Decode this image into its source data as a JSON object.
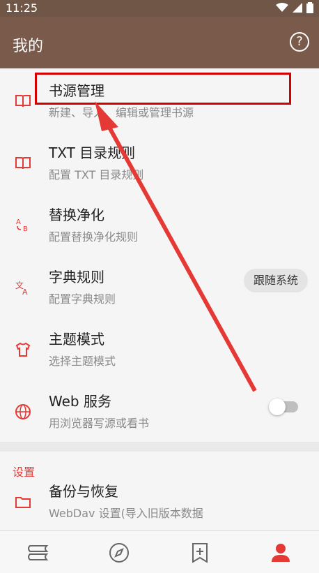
{
  "status": {
    "time": "11:25"
  },
  "appbar": {
    "title": "我的",
    "help_label": "?"
  },
  "items": [
    {
      "title": "书源管理",
      "subtitle": "新建、导入、编辑或管理书源",
      "icon": "book-icon"
    },
    {
      "title": "TXT 目录规则",
      "subtitle": "配置 TXT 目录规则",
      "icon": "book-icon"
    },
    {
      "title": "替换净化",
      "subtitle": "配置替换净化规则",
      "icon": "replace-ab-icon"
    },
    {
      "title": "字典规则",
      "subtitle": "配置字典规则",
      "icon": "translate-icon"
    },
    {
      "title": "主题模式",
      "subtitle": "选择主题模式",
      "icon": "shirt-icon",
      "value": "跟随系统"
    },
    {
      "title": "Web 服务",
      "subtitle": "用浏览器写源或看书",
      "icon": "globe-icon",
      "toggle": false
    },
    {
      "title": "备份与恢复",
      "subtitle": "WebDav 设置(导入旧版本数据",
      "icon": "folder-icon"
    }
  ],
  "section_settings": {
    "title": "设置"
  },
  "bottom_nav": [
    "bookshelf-icon",
    "compass-icon",
    "bookmark-add-icon",
    "person-icon"
  ],
  "colors": {
    "appbar": "#7a5a4a",
    "accent": "#e53935",
    "highlight": "#d40000"
  }
}
